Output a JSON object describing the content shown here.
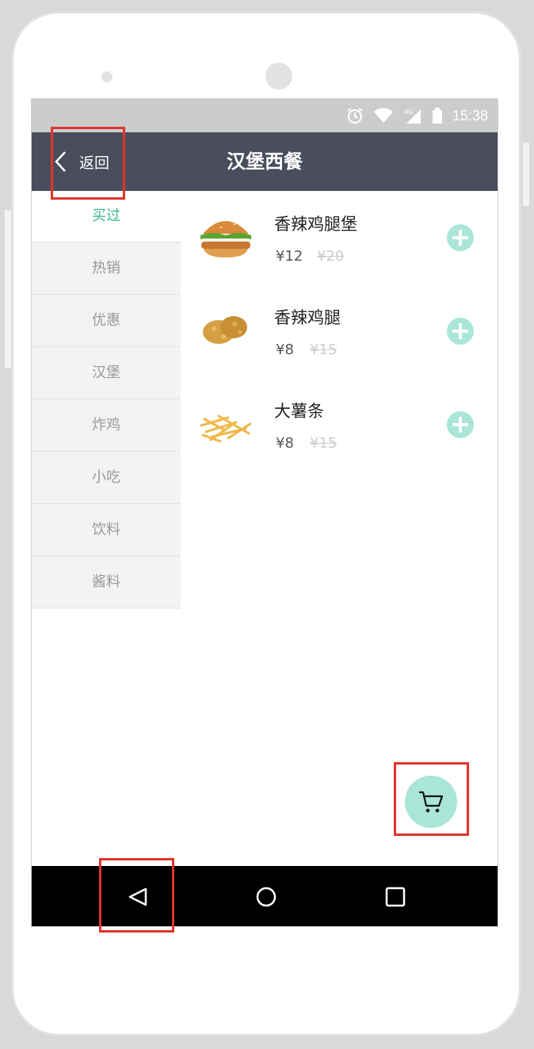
{
  "status_bar": {
    "time": "15:38"
  },
  "header": {
    "back_label": "返回",
    "title": "汉堡西餐"
  },
  "categories": [
    {
      "label": "买过",
      "active": true
    },
    {
      "label": "热销",
      "active": false
    },
    {
      "label": "优惠",
      "active": false
    },
    {
      "label": "汉堡",
      "active": false
    },
    {
      "label": "炸鸡",
      "active": false
    },
    {
      "label": "小吃",
      "active": false
    },
    {
      "label": "饮料",
      "active": false
    },
    {
      "label": "酱料",
      "active": false
    }
  ],
  "products": [
    {
      "name": "香辣鸡腿堡",
      "price": "¥12",
      "original_price": "¥20",
      "image": "burger-image"
    },
    {
      "name": "香辣鸡腿",
      "price": "¥8",
      "original_price": "¥15",
      "image": "chicken-drumstick-image"
    },
    {
      "name": "大薯条",
      "price": "¥8",
      "original_price": "¥15",
      "image": "fries-image"
    }
  ],
  "icons": {
    "back": "chevron-left-icon",
    "cart": "cart-icon",
    "add": "plus-icon",
    "system_back": "triangle-back-icon",
    "system_home": "circle-home-icon",
    "system_recents": "square-recents-icon"
  },
  "colors": {
    "nav_bar": "#4a4e5c",
    "accent": "#3bb592",
    "add_button": "#a9e6d8",
    "highlight": "#e0342d"
  }
}
